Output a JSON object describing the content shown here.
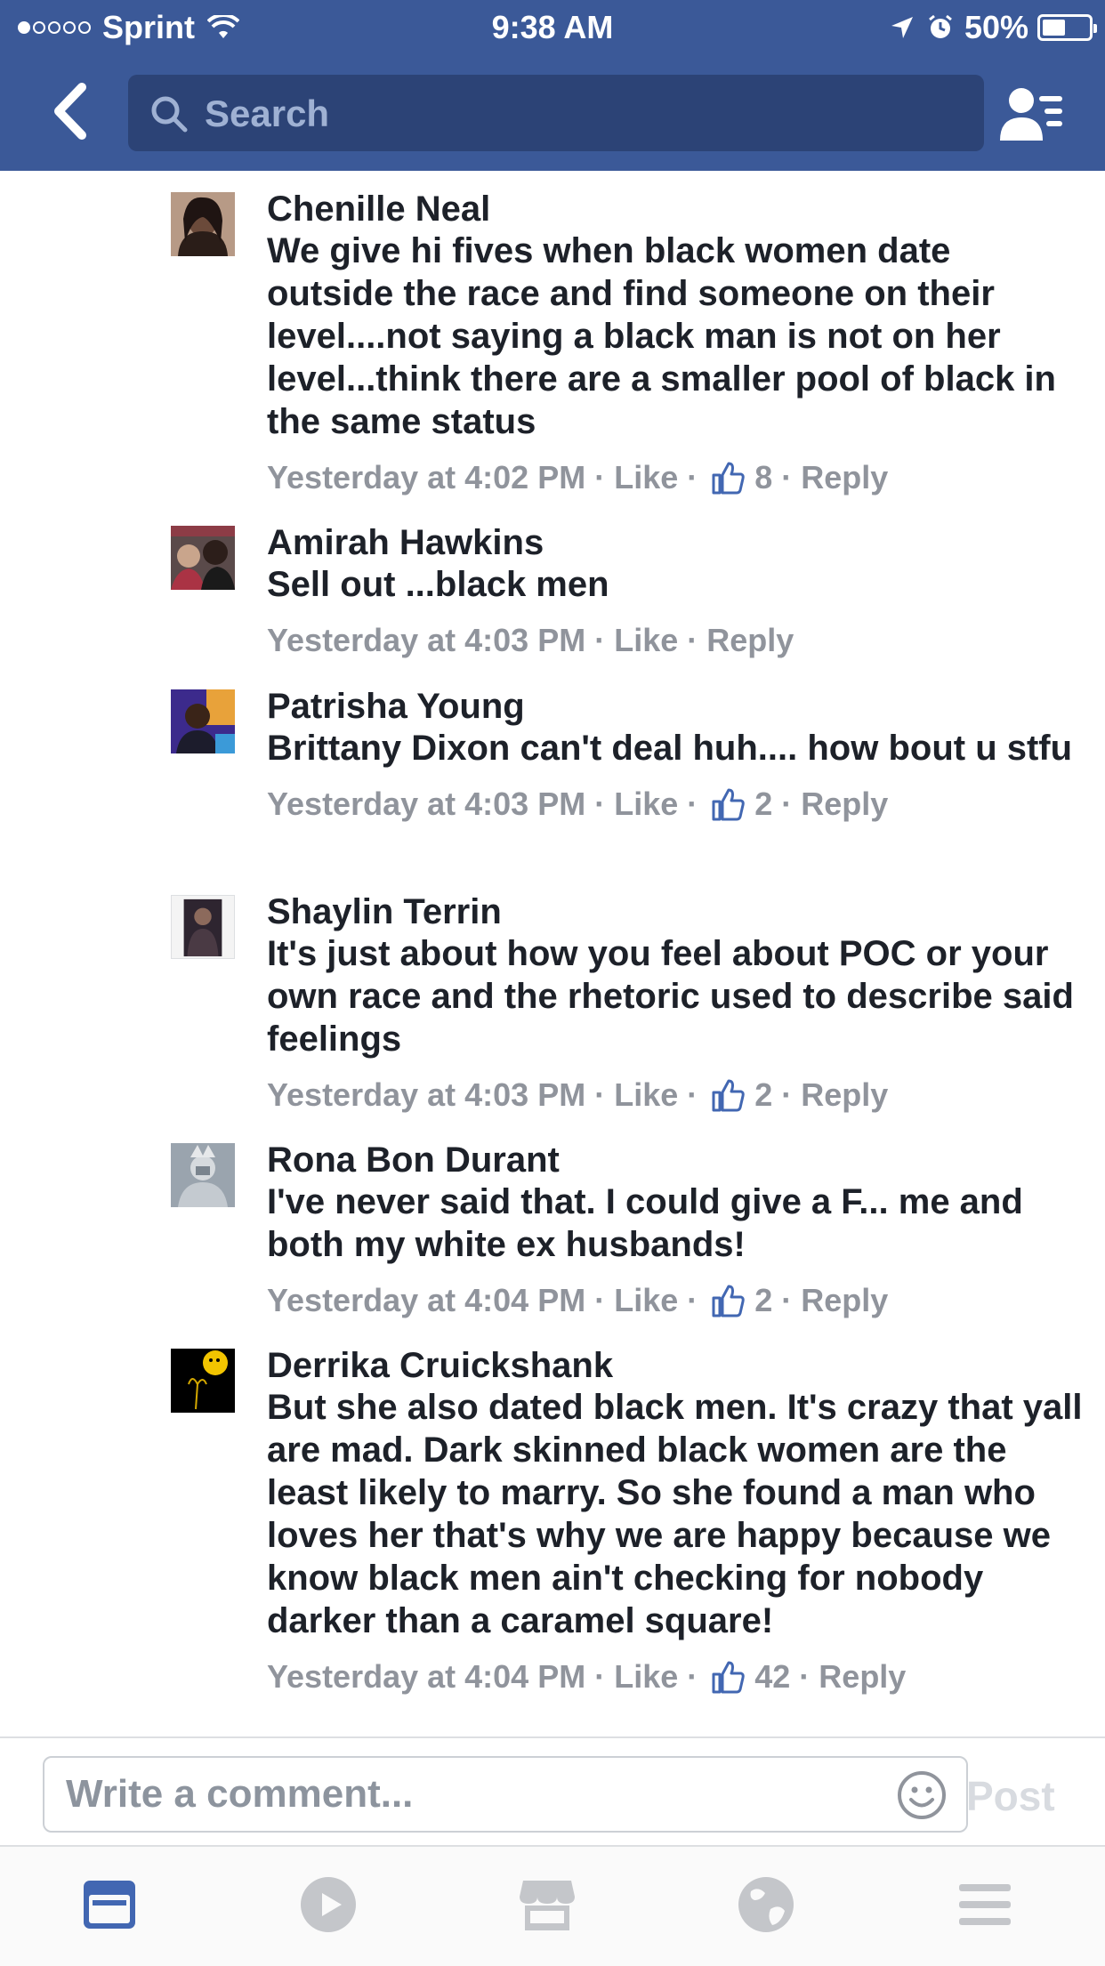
{
  "status_bar": {
    "carrier": "Sprint",
    "time": "9:38 AM",
    "battery": "50%",
    "battery_level": 0.5,
    "signal_bars": 1
  },
  "nav": {
    "search_placeholder": "Search"
  },
  "comments": [
    {
      "name": "Chenille Neal",
      "text": "We give hi fives  when black women date outside the race and find someone  on their level....not saying a black man is not  on her level...think there are a smaller pool of black in the same status",
      "time": "Yesterday at 4:02 PM",
      "like": "Like",
      "likes": "8",
      "reply": "Reply"
    },
    {
      "name": "Amirah Hawkins",
      "text": "Sell out ...black men",
      "time": "Yesterday at 4:03 PM",
      "like": "Like",
      "reply": "Reply"
    },
    {
      "name": "Patrisha Young",
      "text": "Brittany Dixon can't deal huh.... how bout u stfu",
      "time": "Yesterday at 4:03 PM",
      "like": "Like",
      "likes": "2",
      "reply": "Reply"
    },
    {
      "name": "Shaylin Terrin",
      "text": "It's just about how you feel about POC or your own race and the rhetoric used to describe said feelings",
      "time": "Yesterday at 4:03 PM",
      "like": "Like",
      "likes": "2",
      "reply": "Reply"
    },
    {
      "name": "Rona Bon Durant",
      "text": "I've never said that. I could give a F... me and both my white ex husbands!",
      "time": "Yesterday at 4:04 PM",
      "like": "Like",
      "likes": "2",
      "reply": "Reply"
    },
    {
      "name": "Derrika Cruickshank",
      "text": "But she also dated black men. It's crazy that yall are mad. Dark skinned black women are the least likely to marry. So she found a man who loves her that's why we are happy because we know black men ain't checking for nobody darker than a caramel square!",
      "time": "Yesterday at 4:04 PM",
      "like": "Like",
      "likes": "42",
      "reply": "Reply"
    }
  ],
  "composer": {
    "placeholder": "Write a comment...",
    "post_label": "Post"
  },
  "tabbar": {
    "tabs": [
      "news-feed-icon",
      "video-icon",
      "marketplace-icon",
      "notifications-globe-icon",
      "menu-icon"
    ],
    "active": "news-feed-icon"
  },
  "colors": {
    "header": "#3b5998",
    "search_bg": "#2c4376",
    "meta_gray": "#90949c",
    "accent": "#4267b2",
    "tab_inactive": "#c4c6ca"
  }
}
